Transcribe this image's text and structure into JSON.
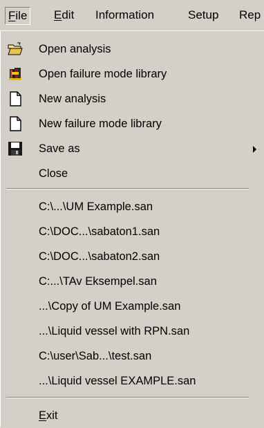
{
  "menubar": {
    "file": "File",
    "edit": "Edit",
    "information": "Information",
    "setup": "Setup",
    "rep": "Rep"
  },
  "menu": {
    "open_analysis": "Open analysis",
    "open_library": "Open failure mode library",
    "new_analysis": "New analysis",
    "new_library": "New failure mode library",
    "save_as": "Save as",
    "close": "Close",
    "recent_files": [
      "C:\\...\\UM Example.san",
      "C:\\DOC...\\sabaton1.san",
      "C:\\DOC...\\sabaton2.san",
      "C:...\\TAv Eksempel.san",
      "...\\Copy of UM Example.san",
      "...\\Liquid vessel with RPN.san",
      "C:\\user\\Sab...\\test.san",
      "...\\Liquid vessel EXAMPLE.san"
    ],
    "exit": "Exit"
  },
  "icons": {
    "open_analysis": "open-folder-icon",
    "open_library": "library-books-icon",
    "new_analysis": "new-document-icon",
    "new_library": "new-document-icon",
    "save_as": "floppy-disk-icon"
  }
}
